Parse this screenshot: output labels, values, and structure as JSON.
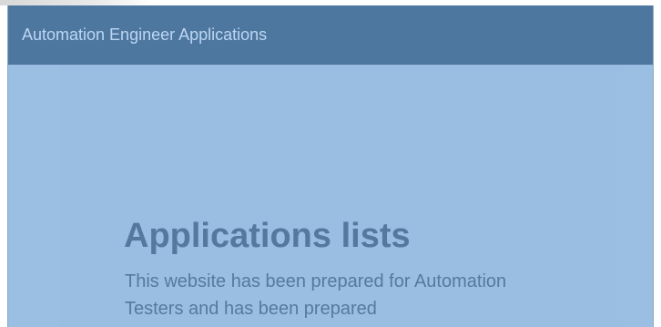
{
  "navbar": {
    "brand": "Automation Engineer Applications"
  },
  "hero": {
    "title": "Applications lists",
    "description": "This website has been prepared for Automation Testers and has been prepared"
  },
  "colors": {
    "navbar_bg": "#4e77a0",
    "page_bg": "#9bbfe3",
    "title_text": "#55799e"
  }
}
